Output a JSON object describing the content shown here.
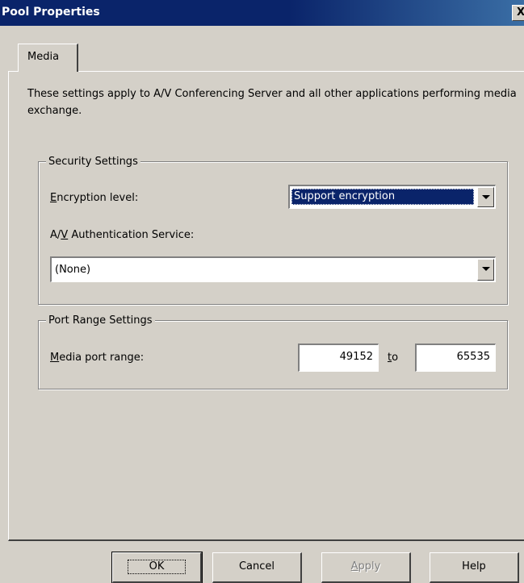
{
  "window": {
    "title": "Pool Properties",
    "close_glyph": "X"
  },
  "tabs": [
    {
      "label": "Media",
      "selected": true
    }
  ],
  "description": "These settings apply to A/V Conferencing Server and all other applications performing media exchange.",
  "security_settings": {
    "title": "Security Settings",
    "encryption_level": {
      "label_hotkey": "E",
      "label_rest": "ncryption level:",
      "value": "Support encryption"
    },
    "av_auth_service": {
      "label_before": "A/",
      "label_hotkey": "V",
      "label_after": " Authentication Service:",
      "value": "(None)"
    }
  },
  "port_range_settings": {
    "title": "Port Range Settings",
    "media_port_range": {
      "label_hotkey": "M",
      "label_rest": "edia port range:",
      "from": "49152",
      "to_hotkey": "t",
      "to_rest": "o",
      "to": "65535"
    }
  },
  "buttons": {
    "ok": "OK",
    "cancel": "Cancel",
    "apply_hotkey": "A",
    "apply_rest": "pply",
    "help": "Help"
  },
  "icons": {
    "close": "close-icon",
    "dropdown": "chevron-down-icon"
  },
  "colors": {
    "titlebar": "#0a246a",
    "face": "#d4d0c8",
    "selection": "#0a246a"
  }
}
